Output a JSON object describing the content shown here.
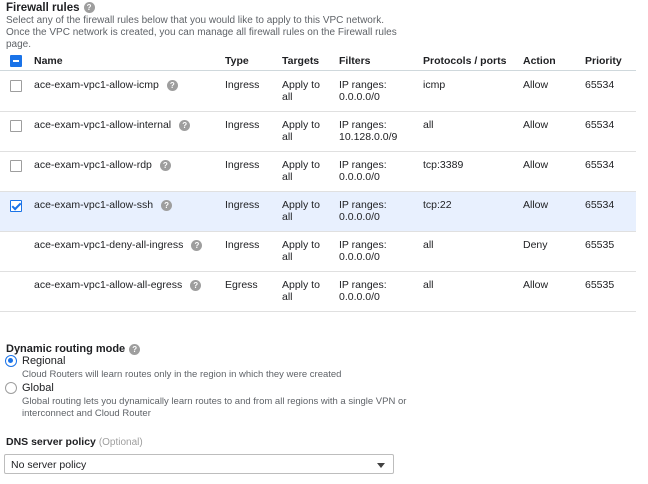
{
  "firewall": {
    "title": "Firewall rules",
    "description": "Select any of the firewall rules below that you would like to apply to this VPC network. Once the VPC network is created, you can manage all firewall rules on the Firewall rules page.",
    "columns": [
      "Name",
      "Type",
      "Targets",
      "Filters",
      "Protocols / ports",
      "Action",
      "Priority"
    ],
    "rows": [
      {
        "name": "ace-exam-vpc1-allow-icmp",
        "type": "Ingress",
        "targets": "Apply to all",
        "filters": "IP ranges: 0.0.0.0/0",
        "proto": "icmp",
        "action": "Allow",
        "priority": "65534",
        "checkbox": "unchecked"
      },
      {
        "name": "ace-exam-vpc1-allow-internal",
        "type": "Ingress",
        "targets": "Apply to all",
        "filters": "IP ranges: 10.128.0.0/9",
        "proto": "all",
        "action": "Allow",
        "priority": "65534",
        "checkbox": "unchecked"
      },
      {
        "name": "ace-exam-vpc1-allow-rdp",
        "type": "Ingress",
        "targets": "Apply to all",
        "filters": "IP ranges: 0.0.0.0/0",
        "proto": "tcp:3389",
        "action": "Allow",
        "priority": "65534",
        "checkbox": "unchecked"
      },
      {
        "name": "ace-exam-vpc1-allow-ssh",
        "type": "Ingress",
        "targets": "Apply to all",
        "filters": "IP ranges: 0.0.0.0/0",
        "proto": "tcp:22",
        "action": "Allow",
        "priority": "65534",
        "checkbox": "checked"
      },
      {
        "name": "ace-exam-vpc1-deny-all-ingress",
        "type": "Ingress",
        "targets": "Apply to all",
        "filters": "IP ranges: 0.0.0.0/0",
        "proto": "all",
        "action": "Deny",
        "priority": "65535",
        "checkbox": "none"
      },
      {
        "name": "ace-exam-vpc1-allow-all-egress",
        "type": "Egress",
        "targets": "Apply to all",
        "filters": "IP ranges: 0.0.0.0/0",
        "proto": "all",
        "action": "Allow",
        "priority": "65535",
        "checkbox": "none"
      }
    ]
  },
  "routing": {
    "title": "Dynamic routing mode",
    "options": [
      {
        "label": "Regional",
        "description": "Cloud Routers will learn routes only in the region in which they were created",
        "selected": true
      },
      {
        "label": "Global",
        "description": "Global routing lets you dynamically learn routes to and from all regions with a single VPN or interconnect and Cloud Router",
        "selected": false
      }
    ]
  },
  "dns": {
    "title": "DNS server policy",
    "optional": "(Optional)",
    "value": "No server policy"
  },
  "colors": {
    "accent": "#1a73e8",
    "selected_row": "#e8f0fe"
  }
}
